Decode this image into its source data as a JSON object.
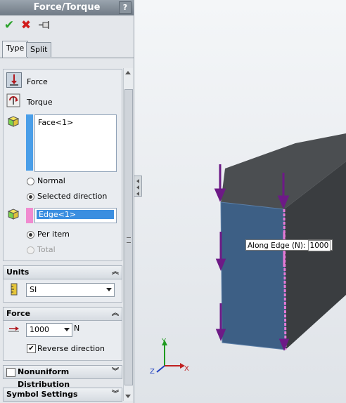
{
  "panel": {
    "title": "Force/Torque",
    "help": "?",
    "toolbar": {
      "ok": "✔",
      "cancel": "✖",
      "pin": "pin-icon"
    },
    "tabs": [
      {
        "label": "Type",
        "active": true
      },
      {
        "label": "Split",
        "active": false
      }
    ],
    "type_group": {
      "options": [
        {
          "label": "Force",
          "selected": true
        },
        {
          "label": "Torque",
          "selected": false
        }
      ],
      "selection_list": [
        "Face<1>"
      ],
      "direction_options": [
        {
          "label": "Normal",
          "selected": false
        },
        {
          "label": "Selected direction",
          "selected": true
        }
      ],
      "direction_reference": "Edge<1>",
      "distribution_options": [
        {
          "label": "Per item",
          "selected": true,
          "enabled": true
        },
        {
          "label": "Total",
          "selected": false,
          "enabled": false
        }
      ]
    },
    "units": {
      "header": "Units",
      "value": "SI"
    },
    "force": {
      "header": "Force",
      "value": "1000",
      "unit": "N",
      "reverse_label": "Reverse direction",
      "reverse_checked": true
    },
    "nonuniform": {
      "header": "Nonuniform Distribution",
      "checked": false
    },
    "symbol_settings": {
      "header": "Symbol Settings"
    }
  },
  "viewport": {
    "callout_label": "Along Edge (N):",
    "callout_value": "1000",
    "axes": {
      "x": "X",
      "y": "Y",
      "z": "Z"
    }
  },
  "colors": {
    "face_blue": "#3d5f85",
    "body_dark": "#3c3f42",
    "arrow_purple": "#6d1a86",
    "edge_pink": "#e67ad8"
  }
}
